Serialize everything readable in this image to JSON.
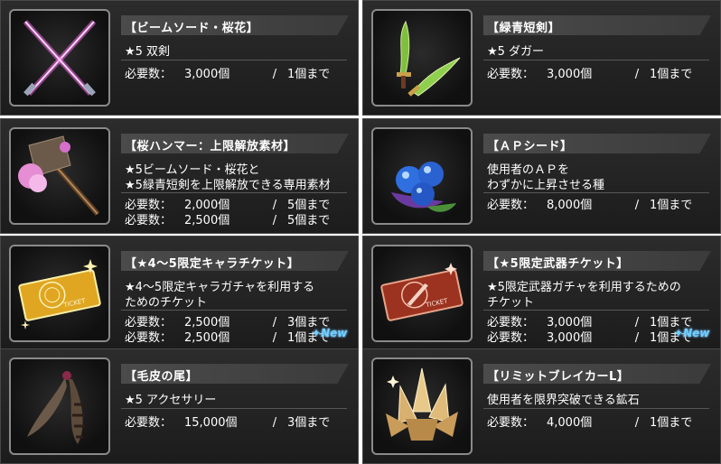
{
  "items": [
    {
      "title": "【ビームソード・桜花】",
      "desc": [
        "★5 双剣"
      ],
      "requirements": [
        {
          "label": "必要数：",
          "count": "3,000個",
          "slash": "/",
          "limit": "1個まで",
          "new": false
        }
      ]
    },
    {
      "title": "【緑青短剣】",
      "desc": [
        "★5 ダガー"
      ],
      "requirements": [
        {
          "label": "必要数：",
          "count": "3,000個",
          "slash": "/",
          "limit": "1個まで",
          "new": false
        }
      ]
    },
    {
      "title": "【桜ハンマー：上限解放素材】",
      "desc": [
        "★5ビームソード・桜花と",
        "★5緑青短剣を上限解放できる専用素材"
      ],
      "requirements": [
        {
          "label": "必要数：",
          "count": "2,000個",
          "slash": "/",
          "limit": "5個まで",
          "new": false
        },
        {
          "label": "必要数：",
          "count": "2,500個",
          "slash": "/",
          "limit": "5個まで",
          "new": false
        }
      ]
    },
    {
      "title": "【ＡＰシード】",
      "desc": [
        "使用者のＡＰを",
        "わずかに上昇させる種"
      ],
      "requirements": [
        {
          "label": "必要数：",
          "count": "8,000個",
          "slash": "/",
          "limit": "1個まで",
          "new": false
        }
      ]
    },
    {
      "title": "【★4～5限定キャラチケット】",
      "desc": [
        "★4～5限定キャラガチャを利用する",
        "ためのチケット"
      ],
      "requirements": [
        {
          "label": "必要数：",
          "count": "2,500個",
          "slash": "/",
          "limit": "3個まで",
          "new": false
        },
        {
          "label": "必要数：",
          "count": "2,500個",
          "slash": "/",
          "limit": "1個まで",
          "new": true
        }
      ]
    },
    {
      "title": "【★5限定武器チケット】",
      "desc": [
        "★5限定武器ガチャを利用するための",
        "チケット"
      ],
      "requirements": [
        {
          "label": "必要数：",
          "count": "3,000個",
          "slash": "/",
          "limit": "1個まで",
          "new": false
        },
        {
          "label": "必要数：",
          "count": "3,000個",
          "slash": "/",
          "limit": "1個まで",
          "new": true
        }
      ]
    },
    {
      "title": "【毛皮の尾】",
      "desc": [
        "★5 アクセサリー"
      ],
      "requirements": [
        {
          "label": "必要数：",
          "count": "15,000個",
          "slash": "/",
          "limit": "3個まで",
          "new": false
        }
      ]
    },
    {
      "title": "【リミットブレイカーL】",
      "desc": [
        "使用者を限界突破できる鉱石"
      ],
      "requirements": [
        {
          "label": "必要数：",
          "count": "4,000個",
          "slash": "/",
          "limit": "1個まで",
          "new": false
        }
      ]
    }
  ],
  "new_label": "New",
  "ticket_text": "TICKET",
  "icons": [
    "beam-sword-icon",
    "green-dagger-icon",
    "sakura-hammer-icon",
    "ap-seed-icon",
    "chara-ticket-icon",
    "weapon-ticket-icon",
    "fur-tail-icon",
    "limit-breaker-crystal-icon"
  ]
}
